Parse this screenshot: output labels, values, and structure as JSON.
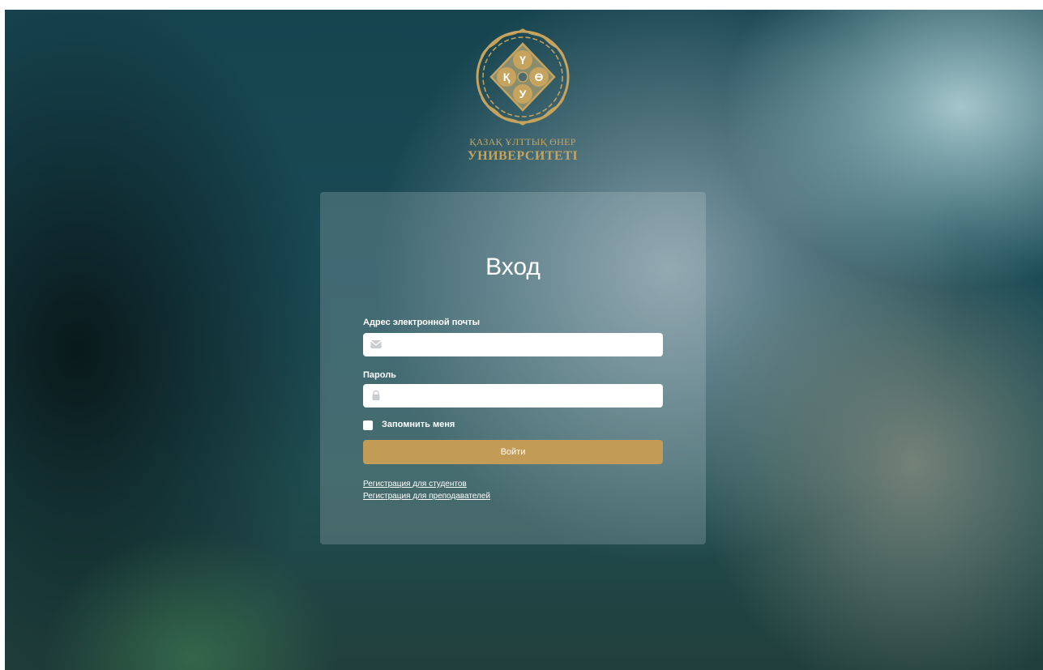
{
  "branding": {
    "emblem_name": "kazakh-national-arts-university-emblem",
    "name_line1": "ҚАЗАҚ ҰЛТТЫҚ ӨНЕР",
    "name_line2": "УНИВЕРСИТЕТІ",
    "emblem_letters": [
      "Қ",
      "Ү",
      "Ө",
      "У"
    ],
    "accent_color": "#c7a45e"
  },
  "login": {
    "title": "Вход",
    "email_label": "Адрес электронной почты",
    "email_value": "",
    "email_icon": "envelope-icon",
    "password_label": "Пароль",
    "password_value": "",
    "password_icon": "lock-icon",
    "remember_label": "Запомнить меня",
    "remember_checked": false,
    "submit_label": "Войти",
    "submit_color": "#c29b57"
  },
  "links": {
    "register_students": "Регистрация для студентов",
    "register_teachers": "Регистрация для преподавателей"
  }
}
